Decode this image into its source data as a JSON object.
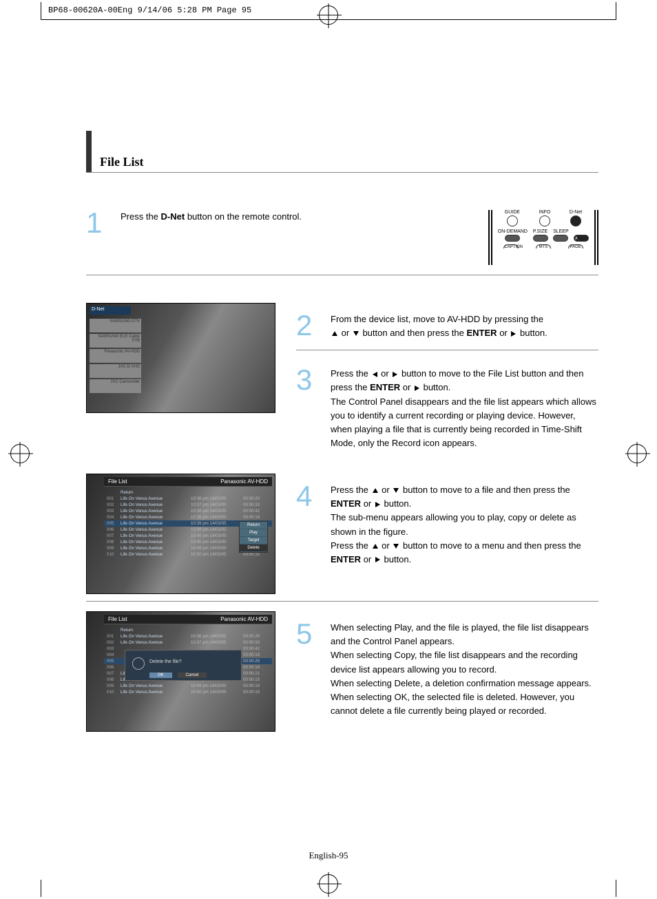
{
  "crop_header": "BP68-00620A-00Eng  9/14/06  5:28 PM  Page 95",
  "section_title": "File List",
  "page_footer": "English-95",
  "or": "or",
  "steps": {
    "s1": {
      "num": "1",
      "a": "Press the ",
      "b": "D-Net",
      "c": " button on the remote control."
    },
    "s2": {
      "num": "2",
      "a": "From the device list, move to AV-HDD by pressing the",
      "b": " button and then press the ",
      "enter": "ENTER",
      "c": " button."
    },
    "s3": {
      "num": "3",
      "a": "Press the ",
      "b": " button to move to the File List button and then press the ",
      "enter": "ENTER",
      "c": " button.",
      "d": "The Control Panel disappears and the file list appears which allows you to identify a current recording or playing device. However, when playing a file that is currently being recorded in Time-Shift Mode, only the Record icon appears."
    },
    "s4": {
      "num": "4",
      "a": "Press the ",
      "b": " button to move to a file and then press the ",
      "enter": "ENTER",
      "c": " button.",
      "d": "The sub-menu appears allowing you to play, copy or delete as shown in the figure.",
      "e": "Press the ",
      "f": " button to move to a menu and then press the ",
      "g": " button."
    },
    "s5": {
      "num": "5",
      "a": "When selecting Play, and the file is played, the file list disappears and the Control Panel appears.",
      "b": "When selecting Copy, the file list disappears and the recording device list appears allowing you to record.",
      "c": "When selecting Delete, a deletion confirmation message appears. When selecting OK, the selected file is deleted. However, you cannot delete a file currently being played or recorded."
    }
  },
  "remote": {
    "guide": "GUIDE",
    "info": "INFO",
    "dnet": "D-Net",
    "ondemand": "ON-DEMAND",
    "psize": "P.SIZE",
    "sleep": "SLEEP",
    "caption": "CAPTION",
    "mts": "MTS",
    "page": "PAGE"
  },
  "shot2": {
    "title": "D-Net",
    "items": [
      "SAMSUNG DTV",
      "SAMSUNG ELE Cable STB",
      "Panasonic AV-HDD",
      "JVC D-VHS",
      "JVC Camcorder"
    ]
  },
  "filelist": {
    "header_left": "File List",
    "header_right": "Panasonic AV-HDD",
    "return": "Return",
    "rows": [
      {
        "n": "001",
        "t": "Life On Venus Avenue",
        "d": "10:36 pm 14/03/05",
        "r": "00:00:20"
      },
      {
        "n": "002",
        "t": "Life On Venus Avenue",
        "d": "10:37 pm 14/03/05",
        "r": "00:00:33"
      },
      {
        "n": "003",
        "t": "Life On Venus Avenue",
        "d": "10:38 pm 14/03/05",
        "r": "00:00:42"
      },
      {
        "n": "004",
        "t": "Life On Venus Avenue",
        "d": "10:38 pm 14/03/05",
        "r": "00:00:19"
      },
      {
        "n": "005",
        "t": "Life On Venus Avenue",
        "d": "10:39 pm 14/03/05",
        "r": "00:00:25"
      },
      {
        "n": "006",
        "t": "Life On Venus Avenue",
        "d": "10:39 pm 14/03/05",
        "r": "00:00:19"
      },
      {
        "n": "007",
        "t": "Life On Venus Avenue",
        "d": "10:40 pm 14/03/05",
        "r": "00:00:21"
      },
      {
        "n": "008",
        "t": "Life On Venus Avenue",
        "d": "10:40 pm 14/03/05",
        "r": "00:00:15"
      },
      {
        "n": "009",
        "t": "Life On Venus Avenue",
        "d": "10:49 pm 14/03/05",
        "r": "00:00:19"
      },
      {
        "n": "010",
        "t": "Life On Venus Avenue",
        "d": "10:50 pm 14/03/05",
        "r": "00:00:15"
      }
    ],
    "submenu": [
      "Return",
      "Play",
      "Target",
      "Delete"
    ],
    "dialog_msg": "Delete the file?",
    "ok": "OK",
    "cancel": "Cancel"
  }
}
